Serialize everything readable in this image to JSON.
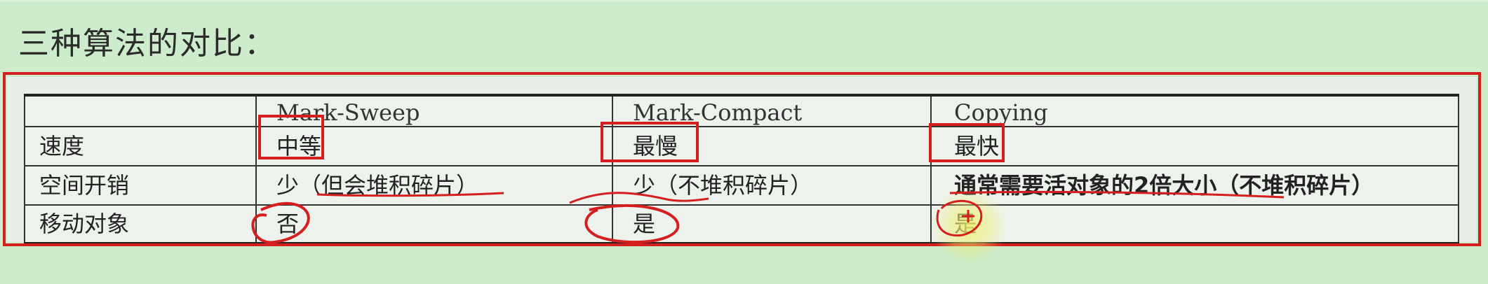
{
  "heading": "三种算法的对比：",
  "table": {
    "headers": [
      "",
      "Mark-Sweep",
      "Mark-Compact",
      "Copying"
    ],
    "rows": [
      {
        "label": "速度",
        "cells": [
          "中等",
          "最慢",
          "最快"
        ]
      },
      {
        "label": "空间开销",
        "cells": [
          "少（但会堆积碎片）",
          "少（不堆积碎片）",
          "通常需要活对象的2倍大小（不堆积碎片）"
        ]
      },
      {
        "label": "移动对象",
        "cells": [
          "否",
          "是",
          "是"
        ]
      }
    ]
  },
  "annotation_color": "#d51f1f",
  "background_color": "#cdeccb"
}
